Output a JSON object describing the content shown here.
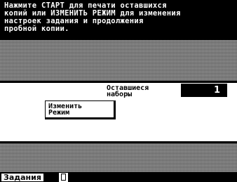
{
  "message": {
    "text": "Нажмите СТАРТ для печати оставшихся\nкопий или ИЗМЕНИТЬ РЕЖИМ для изменения\nнастроек задания и продолжения\nпробной копии."
  },
  "remaining_sets": {
    "label": "Оставшиеся\nнаборы",
    "value": "1"
  },
  "change_mode_button": {
    "label": "Изменить\nРежим"
  },
  "bottom_bar": {
    "jobs_tab_label": "Задания",
    "document_icon": "document-icon"
  },
  "colors": {
    "background": "#000000",
    "panel": "#ffffff",
    "dither_gray": "#8a8a8a"
  }
}
